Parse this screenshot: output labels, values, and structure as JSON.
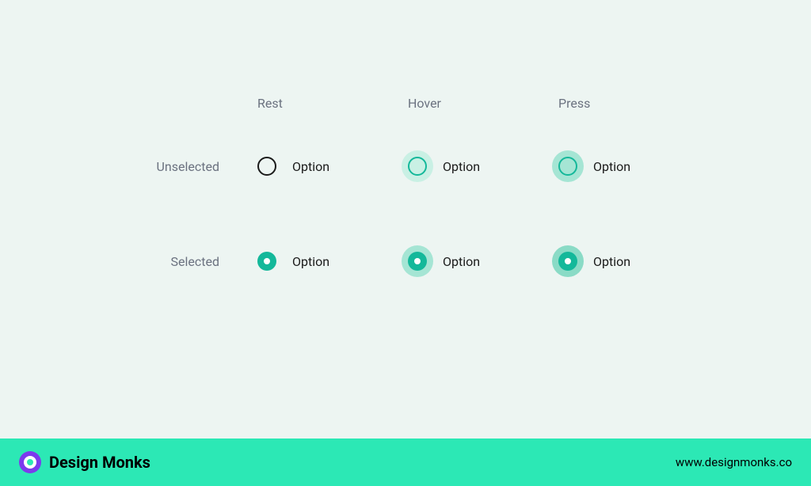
{
  "headers": {
    "columns": {
      "rest": "Rest",
      "hover": "Hover",
      "press": "Press"
    },
    "rows": {
      "unselected": "Unselected",
      "selected": "Selected"
    }
  },
  "option_label": "Option",
  "footer": {
    "brand_name": "Design Monks",
    "url": "www.designmonks.co"
  },
  "colors": {
    "accent": "#14b89a",
    "hover_bg": "#c9f0e4",
    "press_bg": "#a5e5d4",
    "footer_bg": "#2ce8b5",
    "brand_icon": "#7c3aed",
    "page_bg": "#edf5f2"
  }
}
